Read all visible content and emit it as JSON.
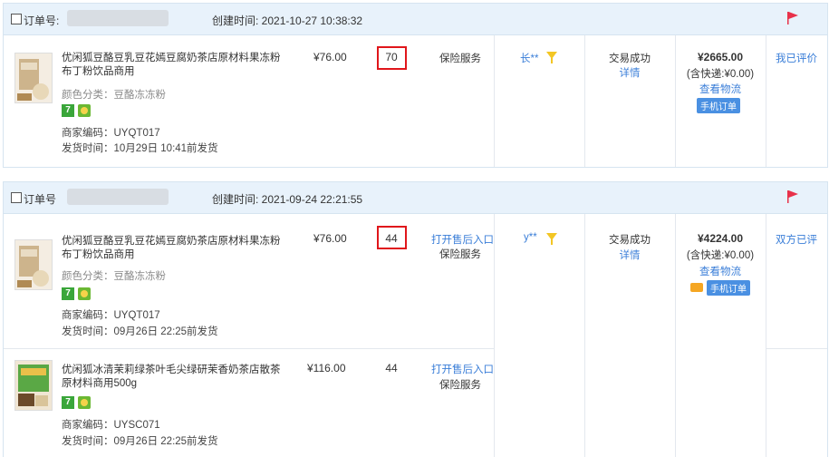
{
  "colors": {
    "link": "#3a7ed8",
    "header_bg": "#e8f2fb",
    "flag": "#e8314a",
    "qty_highlight": "#e0161b",
    "tag": "#4a90e2"
  },
  "orders": [
    {
      "order_label": "订单号:",
      "created": "创建时间: 2021-10-27 10:38:32",
      "items": [
        {
          "title": "优闲狐豆酪豆乳豆花嫣豆腐奶茶店原材料果冻粉布丁粉饮品商用",
          "color": "颜色分类：豆酪冻冻粉",
          "merchant_code": "商家编码：UYQT017",
          "ship_time": "发货时间：10月29日 10:41前发货",
          "price": "¥76.00",
          "qty": "70",
          "service_link": "",
          "service": "保险服务"
        }
      ],
      "buyer": "长**",
      "status": "交易成功",
      "detail": "详情",
      "total": "¥2665.00",
      "shipping": "(含快递:¥0.00)",
      "logistics": "查看物流",
      "mobile_tag": "手机订单",
      "review": "我已评价"
    },
    {
      "order_label": "订单号",
      "created": "创建时间: 2021-09-24 22:21:55",
      "items": [
        {
          "title": "优闲狐豆酪豆乳豆花嫣豆腐奶茶店原材料果冻粉布丁粉饮品商用",
          "color": "颜色分类：豆酪冻冻粉",
          "merchant_code": "商家编码：UYQT017",
          "ship_time": "发货时间：09月26日 22:25前发货",
          "price": "¥76.00",
          "qty": "44",
          "service_link": "打开售后入口",
          "service": "保险服务"
        },
        {
          "title": "优闲狐冰清茉莉绿茶叶毛尖绿研茉香奶茶店散茶原材料商用500g",
          "merchant_code": "商家编码：UYSC071",
          "ship_time": "发货时间：09月26日 22:25前发货",
          "price": "¥116.00",
          "qty": "44",
          "service_link": "打开售后入口",
          "service": "保险服务"
        }
      ],
      "buyer": "y**",
      "status": "交易成功",
      "detail": "详情",
      "total": "¥4224.00",
      "shipping": "(含快递:¥0.00)",
      "logistics": "查看物流",
      "mobile_tag": "手机订单",
      "review": "双方已评"
    }
  ]
}
